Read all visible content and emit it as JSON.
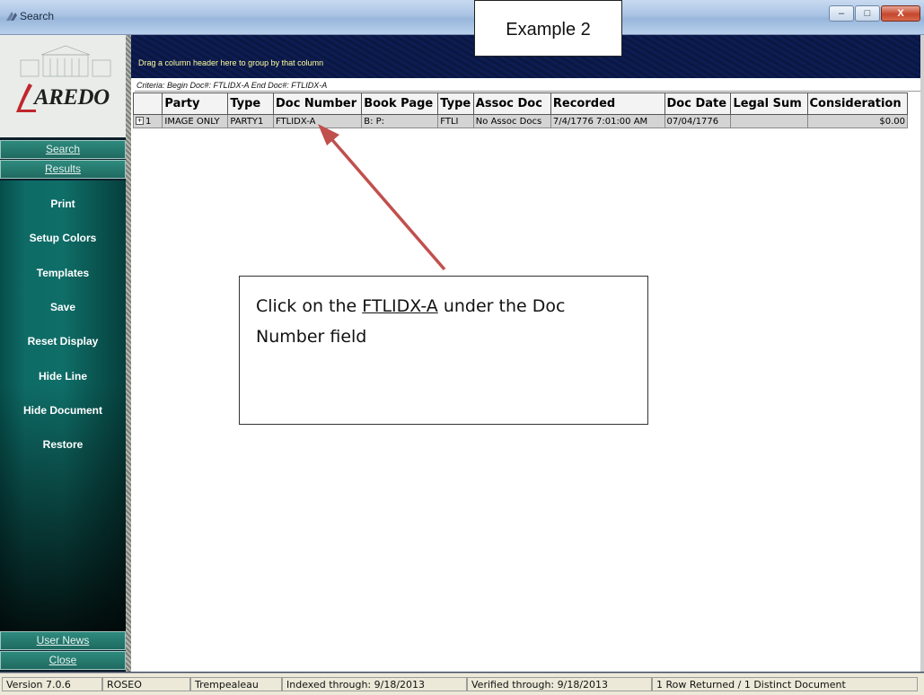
{
  "window": {
    "title": "Search",
    "buttons": {
      "minimize": "–",
      "maximize": "□",
      "close": "X"
    }
  },
  "logo": {
    "text": "AREDO",
    "brand": "LAREDO"
  },
  "sidebar": {
    "top_buttons": [
      "Search",
      "Results"
    ],
    "menu": [
      "Print",
      "Setup Colors",
      "Templates",
      "Save",
      "Reset Display",
      "Hide Line",
      "Hide Document",
      "Restore"
    ],
    "bottom_buttons": [
      "User News",
      "Close"
    ]
  },
  "grid": {
    "group_hint": "Drag a column header here to group by that column",
    "criteria": "Criteria: Begin Doc#: FTLIDX-A End Doc#: FTLIDX-A",
    "columns": [
      "Party",
      "Type",
      "Doc Number",
      "Book Page",
      "Type",
      "Assoc Doc",
      "Recorded",
      "Doc Date",
      "Legal Sum",
      "Consideration"
    ],
    "rows": [
      {
        "expander": "+",
        "index": "1",
        "cells": [
          "IMAGE ONLY",
          "PARTY1",
          "FTLIDX-A",
          "B:  P:",
          "FTLI",
          "No Assoc Docs",
          "7/4/1776 7:01:00 AM",
          "07/04/1776",
          "",
          "$0.00"
        ]
      }
    ]
  },
  "annotations": {
    "example_label": "Example 2",
    "note": {
      "before": "Click on the ",
      "link": "FTLIDX-A",
      "after": " under the Doc Number field"
    },
    "arrow_color": "#c0504d"
  },
  "statusbar": {
    "version": "Version 7.0.6",
    "user": "ROSEO",
    "county": "Trempealeau",
    "indexed": "Indexed through: 9/18/2013",
    "verified": "Verified through: 9/18/2013",
    "rows": "1 Row Returned / 1 Distinct Document"
  },
  "colors": {
    "accent": "#1f6a60",
    "group_bar": "#0a1742",
    "hint_text": "#fefe9f"
  }
}
